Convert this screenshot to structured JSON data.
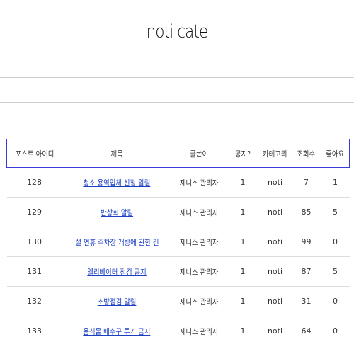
{
  "page": {
    "title": "noti cate"
  },
  "table": {
    "headers": [
      "포스트 아이디",
      "제목",
      "글쓴이",
      "공지?",
      "카테고리",
      "조회수",
      "좋아요"
    ],
    "rows": [
      {
        "id": "128",
        "title": "청소 용역업체 선정 알림",
        "author": "제니스 관리자",
        "notice": "1",
        "category": "noti",
        "views": "7",
        "likes": "1"
      },
      {
        "id": "129",
        "title": "반상회 알림",
        "author": "제니스 관리자",
        "notice": "1",
        "category": "noti",
        "views": "85",
        "likes": "5"
      },
      {
        "id": "130",
        "title": "설 연휴 주차장 개방에 관한 건",
        "author": "제니스 관리자",
        "notice": "1",
        "category": "noti",
        "views": "99",
        "likes": "0"
      },
      {
        "id": "131",
        "title": "엘리베이터 점검 공지",
        "author": "제니스 관리자",
        "notice": "1",
        "category": "noti",
        "views": "87",
        "likes": "5"
      },
      {
        "id": "132",
        "title": "소방점검 알림",
        "author": "제니스 관리자",
        "notice": "1",
        "category": "noti",
        "views": "31",
        "likes": "0"
      },
      {
        "id": "133",
        "title": "음식물 배수구 투기 금지",
        "author": "제니스 관리자",
        "notice": "1",
        "category": "noti",
        "views": "64",
        "likes": "0"
      }
    ]
  }
}
